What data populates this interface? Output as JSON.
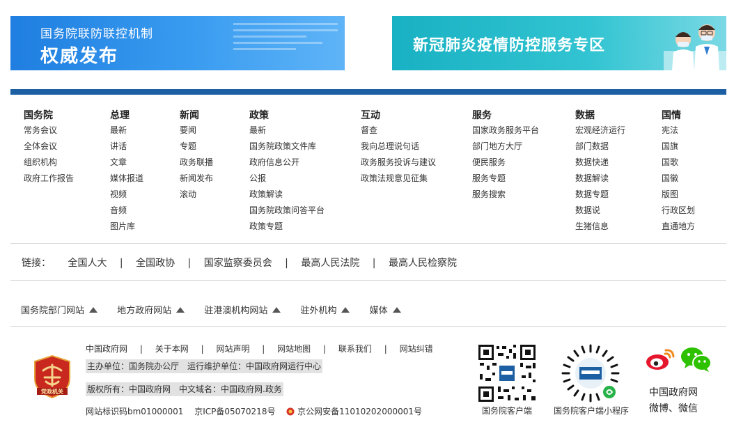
{
  "banners": {
    "left": {
      "subtitle": "国务院联防联控机制",
      "title": "权威发布"
    },
    "right": {
      "title": "新冠肺炎疫情防控服务专区"
    }
  },
  "nav": [
    {
      "heading": "国务院",
      "items": [
        "常务会议",
        "全体会议",
        "组织机构",
        "政府工作报告"
      ]
    },
    {
      "heading": "总理",
      "items": [
        "最新",
        "讲话",
        "文章",
        "媒体报道",
        "视频",
        "音频",
        "图片库"
      ]
    },
    {
      "heading": "新闻",
      "items": [
        "要闻",
        "专题",
        "政务联播",
        "新闻发布",
        "滚动"
      ]
    },
    {
      "heading": "政策",
      "items": [
        "最新",
        "国务院政策文件库",
        "政府信息公开",
        "公报",
        "政策解读",
        "国务院政策问答平台",
        "政策专题"
      ]
    },
    {
      "heading": "互动",
      "items": [
        "督查",
        "我向总理说句话",
        "政务服务投诉与建议",
        "政策法规意见征集"
      ]
    },
    {
      "heading": "服务",
      "items": [
        "国家政务服务平台",
        "部门地方大厅",
        "便民服务",
        "服务专题",
        "服务搜索"
      ]
    },
    {
      "heading": "数据",
      "items": [
        "宏观经济运行",
        "部门数据",
        "数据快递",
        "数据解读",
        "数据专题",
        "数据说",
        "生猪信息"
      ]
    },
    {
      "heading": "国情",
      "items": [
        "宪法",
        "国旗",
        "国歌",
        "国徽",
        "版图",
        "行政区划",
        "直通地方"
      ]
    }
  ],
  "links": {
    "label": "链接：",
    "separator": "|",
    "items": [
      "全国人大",
      "全国政协",
      "国家监察委员会",
      "最高人民法院",
      "最高人民检察院"
    ]
  },
  "dropdowns": [
    "国务院部门网站",
    "地方政府网站",
    "驻港澳机构网站",
    "驻外机构",
    "媒体"
  ],
  "footer": {
    "links": [
      "中国政府网",
      "关于本网",
      "网站声明",
      "网站地图",
      "联系我们",
      "网站纠错"
    ],
    "separator": "|",
    "sponsor": "主办单位：国务院办公厅　运行维护单位：中国政府网运行中心",
    "copyright": "版权所有：中国政府网　中文域名：中国政府网.政务",
    "site_id": "网站标识码bm01000001",
    "icp": "京ICP备05070218号",
    "police": "京公网安备11010202000001号",
    "emblem_text": "党政机关",
    "qr_app_label": "国务院客户端",
    "qr_mini_label": "国务院客户端小程序",
    "social_line1": "中国政府网",
    "social_line2": "微博、微信"
  },
  "colors": {
    "top_line": "#1c5fa3",
    "banner_blue": "#2a8be8",
    "banner_teal": "#22b7c8",
    "emblem_red": "#c8281e"
  }
}
